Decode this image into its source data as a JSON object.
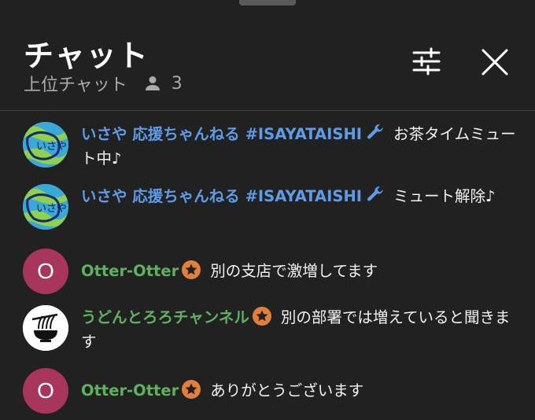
{
  "header": {
    "title": "チャット",
    "subtitle": "上位チャット",
    "viewer_count": "3"
  },
  "messages": [
    {
      "author": "いさや 応援ちゃんねる #ISAYATAISHI",
      "badge": "wrench-icon",
      "text": "お茶タイムミュート中♪",
      "avatar": "image"
    },
    {
      "author": "いさや 応援ちゃんねる #ISAYATAISHI",
      "badge": "wrench-icon",
      "text": "ミュート解除♪",
      "avatar": "image"
    },
    {
      "author": "Otter-Otter",
      "badge": "star-icon",
      "text": "別の支店で激増してます",
      "avatar_letter": "O"
    },
    {
      "author": "うどんとろろチャンネル",
      "badge": "star-icon",
      "text": "別の部署では増えていると聞きます",
      "avatar": "image"
    },
    {
      "author": "Otter-Otter",
      "badge": "star-icon",
      "text": "ありがとうございます",
      "avatar_letter": "O"
    }
  ],
  "colors": {
    "background": "#212121",
    "author_blue": "#5e9be8",
    "author_green": "#5fb05f",
    "badge_orange": "#e0803a",
    "avatar_pink": "#a8365c"
  }
}
